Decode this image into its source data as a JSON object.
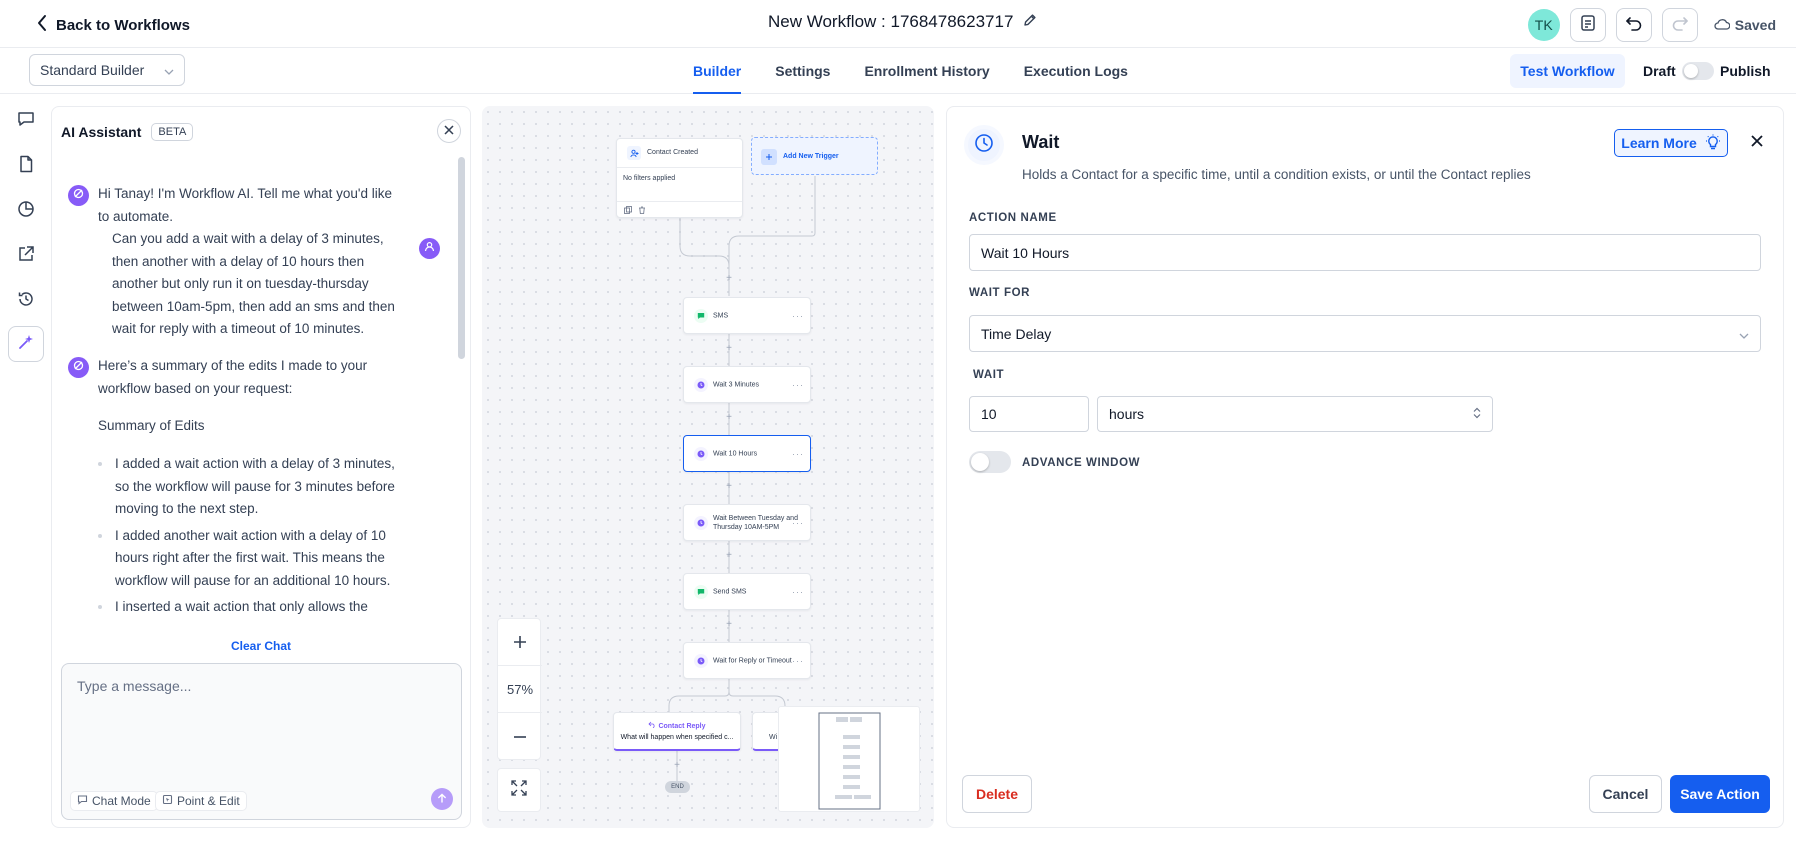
{
  "header": {
    "back_label": "Back to Workflows",
    "workflow_title": "New Workflow : 1768478623717",
    "avatar_initials": "TK",
    "saved_label": "Saved"
  },
  "subbar": {
    "builder_mode": "Standard Builder",
    "tabs": [
      {
        "label": "Builder",
        "active": true
      },
      {
        "label": "Settings",
        "active": false
      },
      {
        "label": "Enrollment History",
        "active": false
      },
      {
        "label": "Execution Logs",
        "active": false
      }
    ],
    "test_label": "Test Workflow",
    "draft_label": "Draft",
    "publish_label": "Publish"
  },
  "ai": {
    "title": "AI Assistant",
    "badge": "BETA",
    "messages": {
      "greeting": "Hi Tanay! I'm Workflow AI. Tell me what you'd like to automate.",
      "user_request": "Can you add a wait with a delay of 3 minutes, then another with a delay of 10 hours then another but only run it on tuesday-thursday between 10am-5pm, then add an sms and then wait for reply with a timeout of 10 minutes.",
      "summary_intro": "Here’s a summary of the edits I made to your workflow based on your request:",
      "summary_heading": "Summary of Edits",
      "bullets": [
        "I added a wait action with a delay of 3 minutes, so the workflow will pause for 3 minutes before moving to the next step.",
        "I added another wait action with a delay of 10 hours right after the first wait. This means the workflow will pause for an additional 10 hours.",
        "I inserted a wait action that only allows the"
      ]
    },
    "clear_chat": "Clear Chat",
    "input_placeholder": "Type a message...",
    "chat_mode": "Chat Mode",
    "point_edit": "Point & Edit"
  },
  "canvas": {
    "trigger": {
      "title": "Contact Created",
      "subtitle": "No filters applied"
    },
    "add_trigger": "Add New Trigger",
    "nodes": [
      {
        "label": "SMS",
        "kind": "sms"
      },
      {
        "label": "Wait 3 Minutes",
        "kind": "wait"
      },
      {
        "label": "Wait 10 Hours",
        "kind": "wait"
      },
      {
        "label": "Wait Between Tuesday and Thursday 10AM-5PM",
        "kind": "wait"
      },
      {
        "label": "Send SMS",
        "kind": "sms"
      },
      {
        "label": "Wait for Reply or Timeout",
        "kind": "wait"
      }
    ],
    "branch_reply": {
      "title": "Contact Reply",
      "subtitle": "What will happen when specified c..."
    },
    "branch_other_prefix": "Wi",
    "end_label": "END",
    "zoom": "57%"
  },
  "panel": {
    "title": "Wait",
    "subtitle": "Holds a Contact for a specific time, until a condition exists, or until the Contact replies",
    "learn_more": "Learn More",
    "action_name_label": "ACTION NAME",
    "action_name_value": "Wait 10 Hours",
    "wait_for_label": "WAIT FOR",
    "wait_for_value": "Time Delay",
    "wait_label": "WAIT",
    "wait_amount": "10",
    "wait_unit": "hours",
    "advance_window_label": "ADVANCE WINDOW",
    "delete_label": "Delete",
    "cancel_label": "Cancel",
    "save_label": "Save Action"
  },
  "colors": {
    "primary": "#155eef",
    "ai_purple": "#875bf7",
    "sms_green": "#12b76a",
    "wait_purple": "#7a5af8",
    "danger": "#d92d20"
  }
}
